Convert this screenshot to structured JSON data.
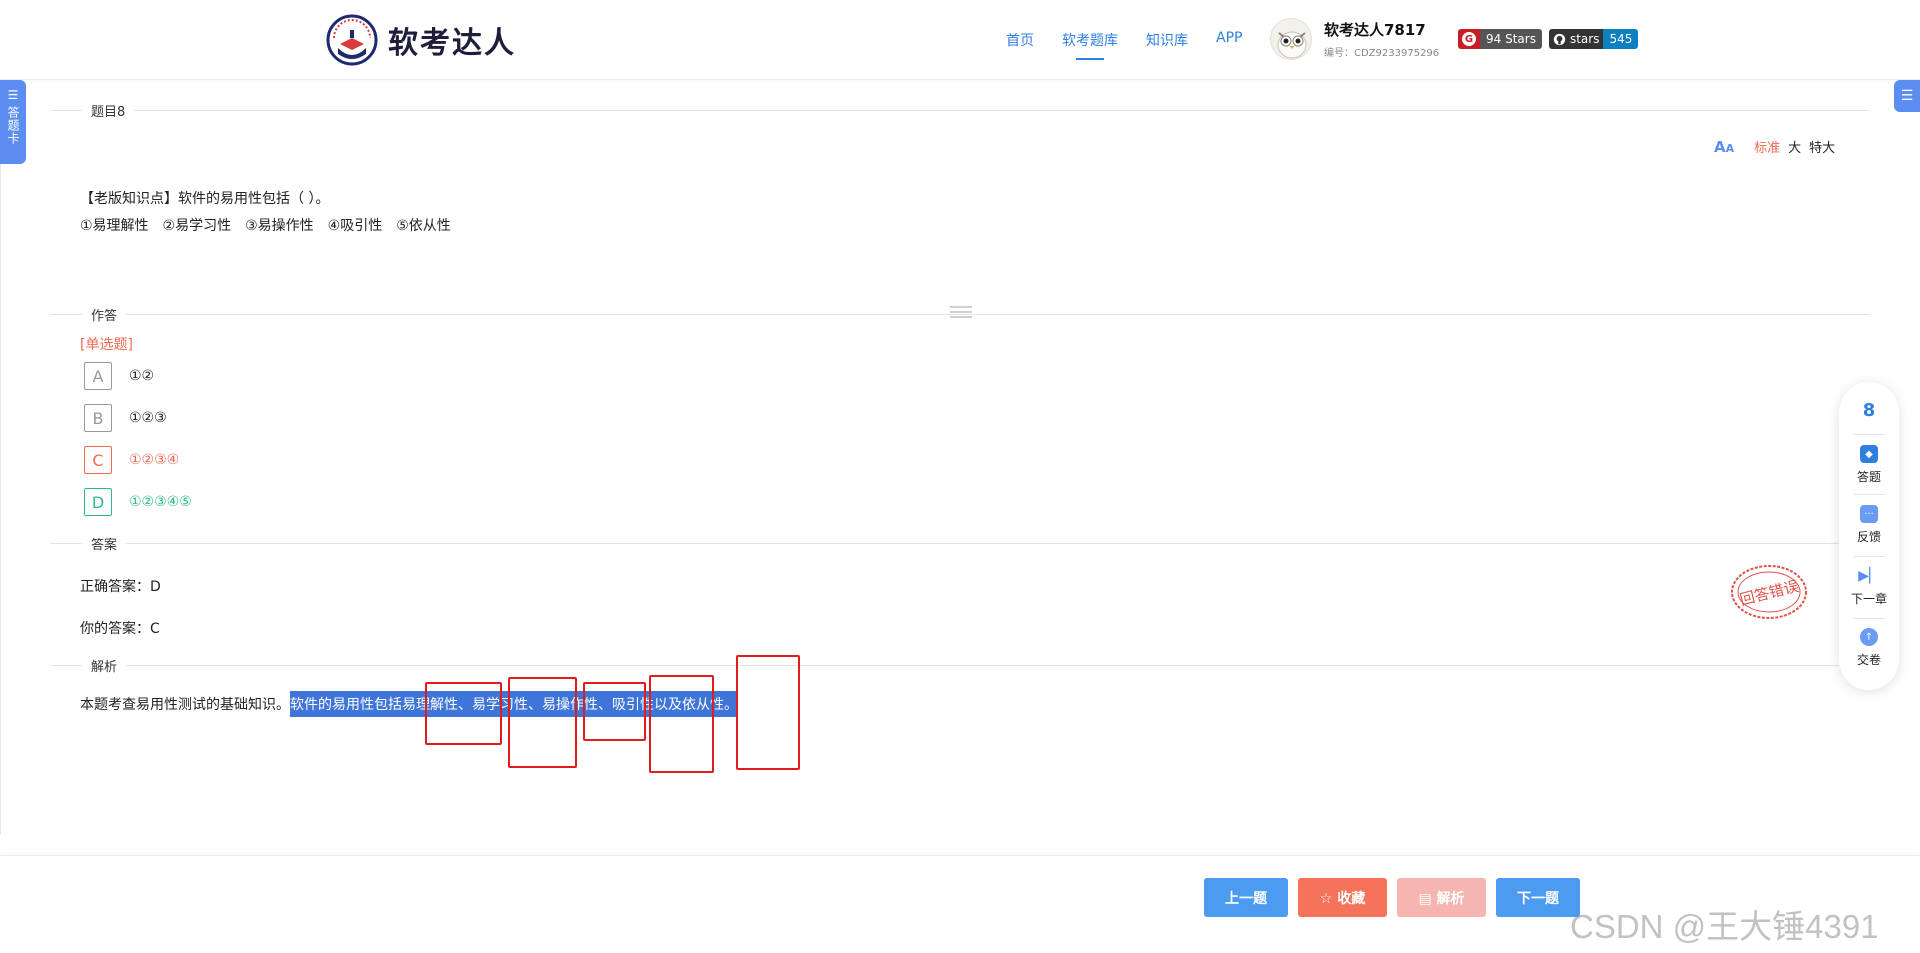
{
  "header": {
    "logo_text": "软考达人",
    "nav": [
      {
        "label": "首页"
      },
      {
        "label": "软考题库"
      },
      {
        "label": "知识库"
      },
      {
        "label": "APP"
      }
    ],
    "user_name": "软考达人7817",
    "user_id": "编号：CDZ9233975296",
    "gitee_badge": "94 Stars",
    "github_badge_left": "stars",
    "github_badge_right": "545"
  },
  "left_tab": {
    "label": "答题卡"
  },
  "question": {
    "section_label": "题目8",
    "font_size_label_standard": "标准",
    "font_size_label_large": "大",
    "font_size_label_xlarge": "特大",
    "stem": "【老版知识点】软件的易用性包括（ ）。",
    "items": "①易理解性　②易学习性　③易操作性　④吸引性　⑤依从性"
  },
  "answer_section": {
    "label": "作答",
    "type": "[单选题]",
    "options": [
      {
        "letter": "A",
        "text": "①②"
      },
      {
        "letter": "B",
        "text": "①②③"
      },
      {
        "letter": "C",
        "text": "①②③④"
      },
      {
        "letter": "D",
        "text": "①②③④⑤"
      }
    ]
  },
  "result": {
    "label": "答案",
    "correct": "正确答案：D",
    "yours": "你的答案：C",
    "stamp": "回答错误"
  },
  "analysis": {
    "label": "解析",
    "plain": "本题考查易用性测试的基础知识。",
    "highlight": "软件的易用性包括易理解性、易学习性、易操作性、吸引性以及依从性。"
  },
  "float_panel": {
    "number": "8",
    "items": [
      {
        "label": "答题",
        "icon": "answer-icon"
      },
      {
        "label": "反馈",
        "icon": "feedback-icon"
      },
      {
        "label": "下一章",
        "icon": "next-chapter-icon"
      },
      {
        "label": "交卷",
        "icon": "submit-icon"
      }
    ]
  },
  "bottom": {
    "prev": "上一题",
    "favorite": "☆ 收藏",
    "analysis": "▤ 解析",
    "next": "下一题"
  },
  "watermark": "CSDN @王大锤4391",
  "colors": {
    "accent": "#2f7fe0",
    "wrong": "#f06a52",
    "right": "#2dbb8b",
    "btn_blue": "#4b9bf0",
    "btn_red": "#f5735a",
    "btn_pink": "#f6b5b1",
    "gitee_right": "#c71d23",
    "github_right": "#0e7fc0"
  }
}
